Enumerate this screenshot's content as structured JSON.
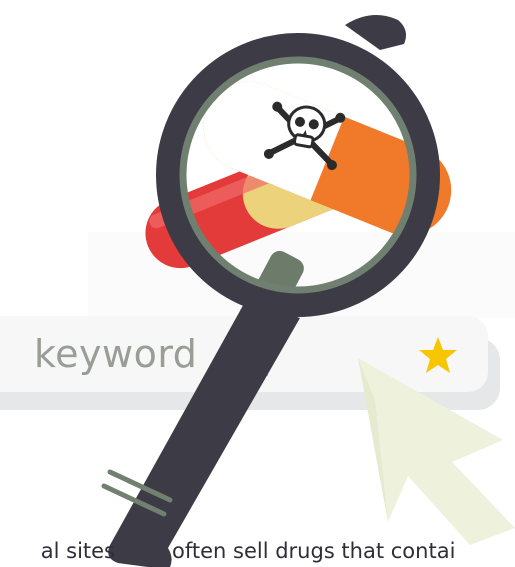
{
  "search": {
    "keyword": "keyword"
  },
  "caption": {
    "left_fragment": "al sites",
    "right_fragment": "often sell drugs that contai"
  },
  "icons": {
    "star": "star-icon",
    "cursor": "cursor-arrow-icon",
    "magnifier": "magnifying-glass-icon",
    "skull": "skull-crossbones-icon"
  },
  "colors": {
    "magnifier_frame": "#3d3b46",
    "magnifier_inner_ring": "#6f8071",
    "handle_stripe": "#71806f",
    "star": "#f7c600",
    "cursor": "#eef1dc",
    "pill_orange": "#f07a2a",
    "pill_red": "#e33b3a",
    "pill_white": "#ffffff"
  }
}
